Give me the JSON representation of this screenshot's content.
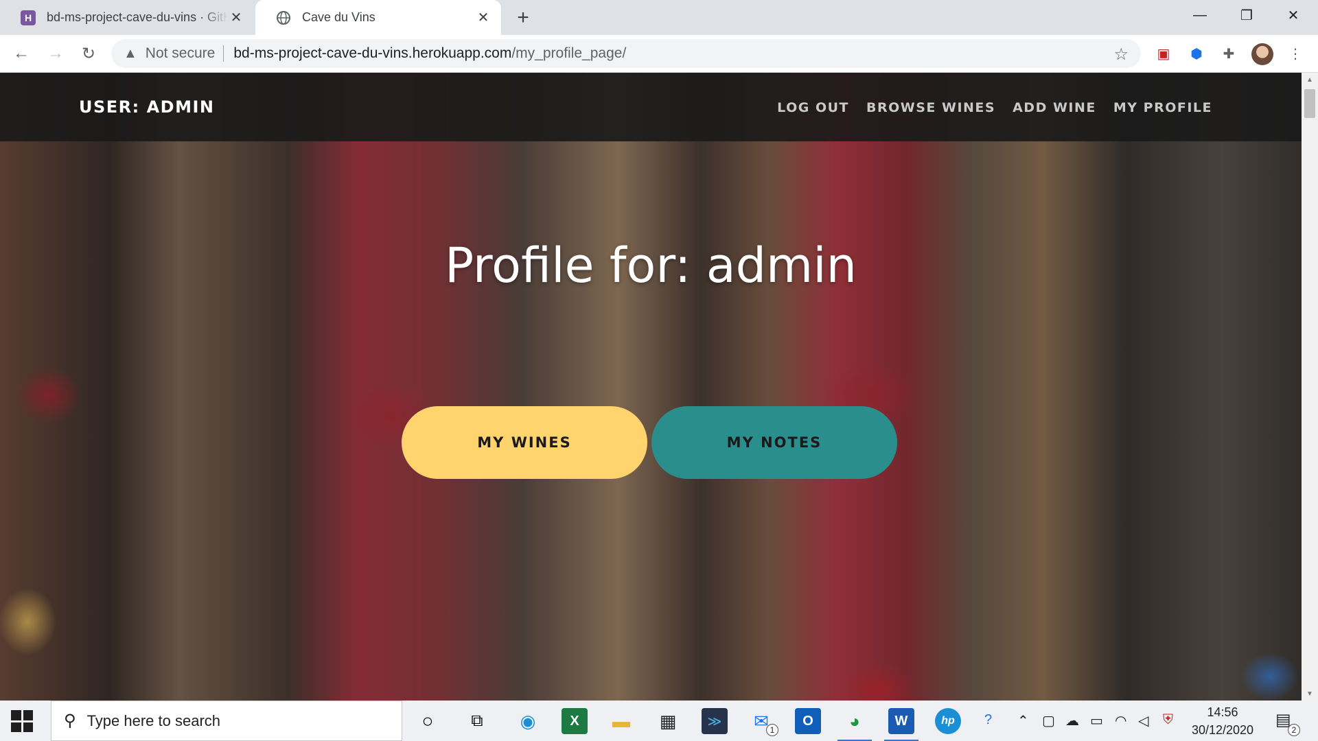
{
  "browser": {
    "tabs": [
      {
        "title": "bd-ms-project-cave-du-vins · GitHub",
        "favicon": "heroku-icon",
        "active": false
      },
      {
        "title": "Cave du Vins",
        "favicon": "globe-icon",
        "active": true
      }
    ],
    "address": {
      "security_label": "Not secure",
      "url_host": "bd-ms-project-cave-du-vins.herokuapp.com",
      "url_path": "/my_profile_page/"
    }
  },
  "site": {
    "brand": "USER: ADMIN",
    "nav": [
      "LOG OUT",
      "BROWSE WINES",
      "ADD WINE",
      "MY PROFILE"
    ],
    "hero_title": "Profile for: admin",
    "buttons": {
      "my_wines": "MY WINES",
      "my_notes": "MY NOTES"
    },
    "colors": {
      "nav_bg": "#191919",
      "yellow_button": "#ffd36e",
      "teal_button": "#2a8f8c"
    }
  },
  "taskbar": {
    "search_placeholder": "Type here to search",
    "time": "14:56",
    "date": "30/12/2020",
    "mail_badge": "1",
    "notification_count": "2"
  }
}
